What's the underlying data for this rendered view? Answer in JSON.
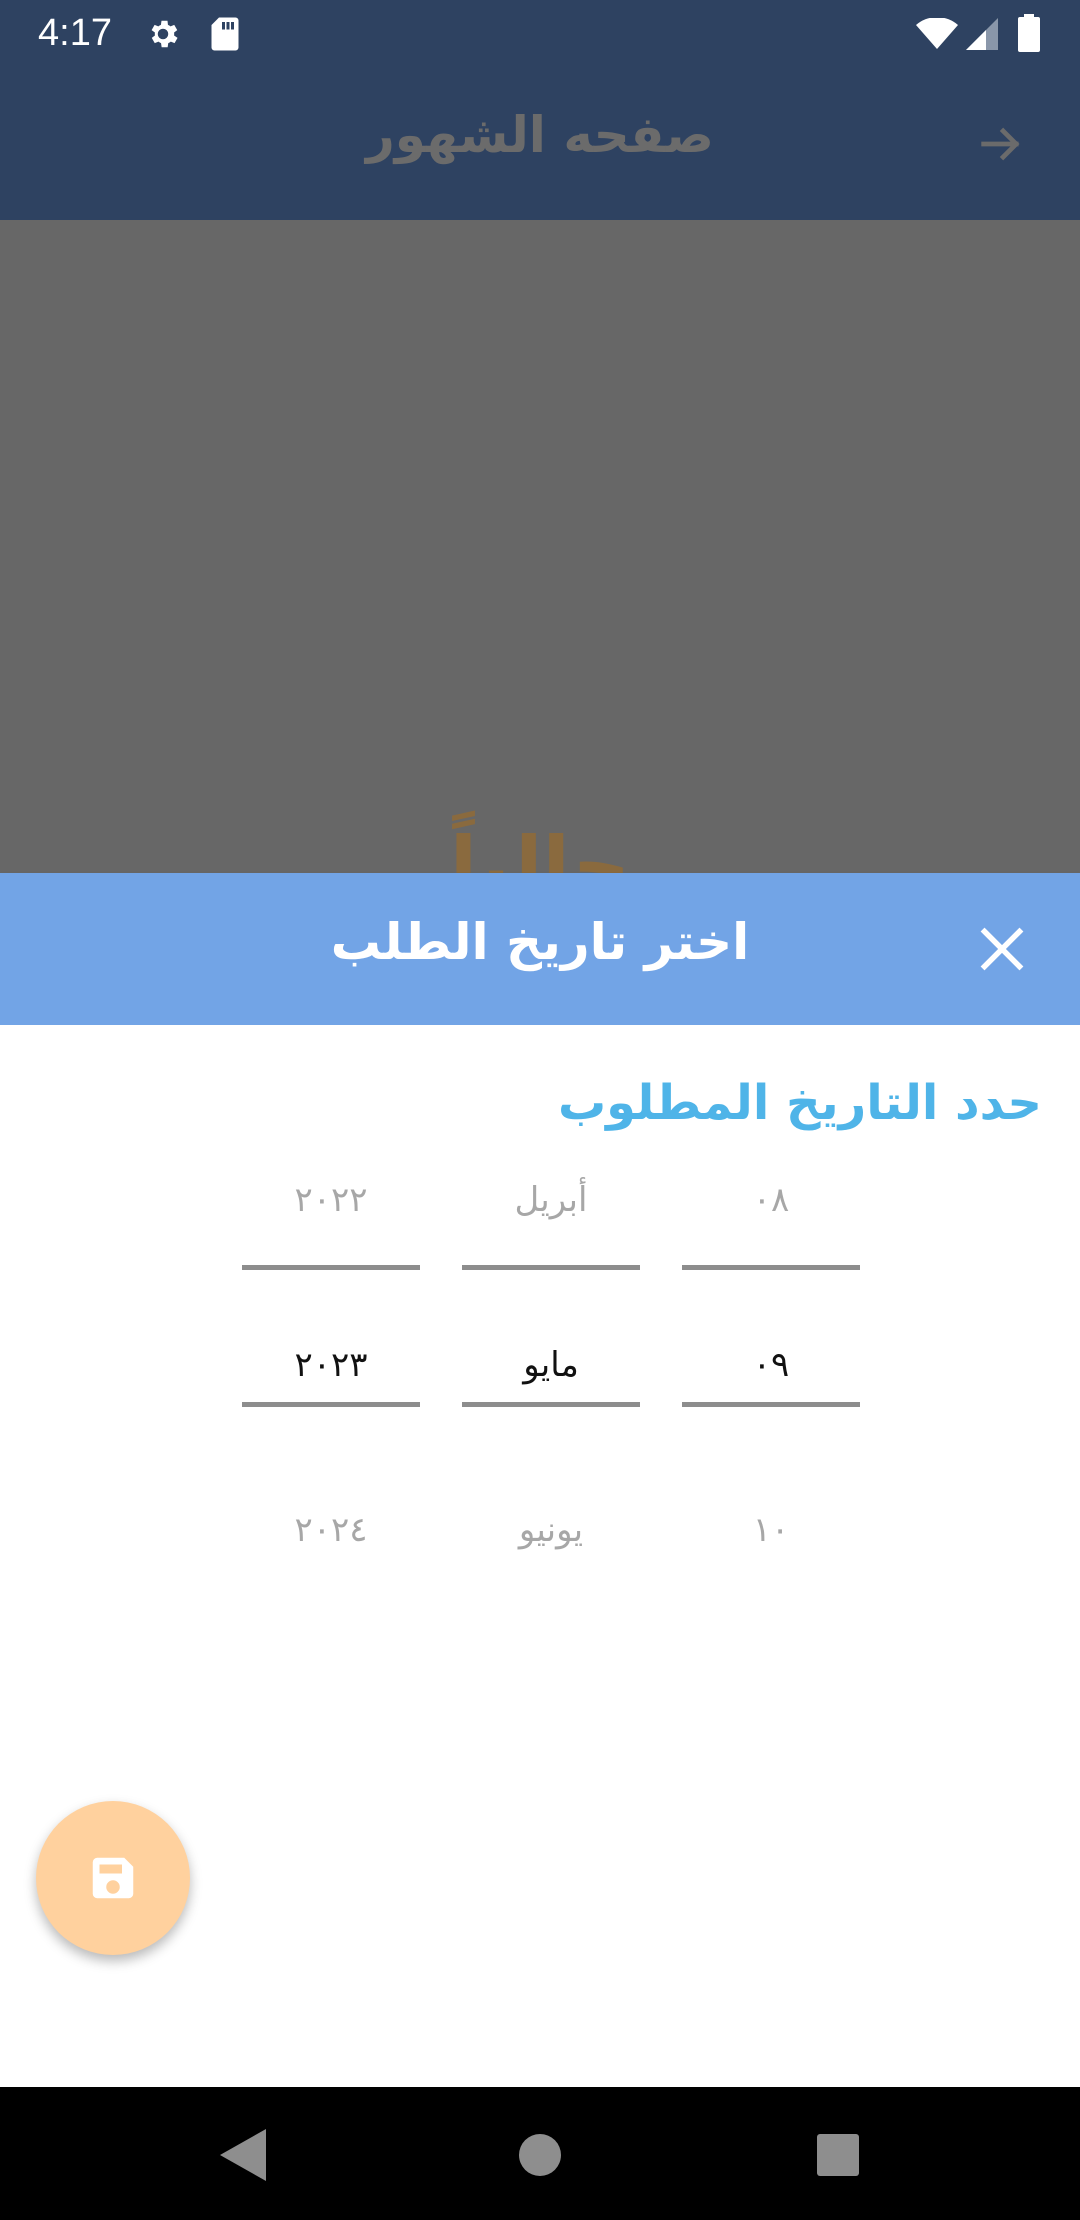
{
  "status_bar": {
    "time": "4:17",
    "icons": [
      "gear-icon",
      "sd-card-icon",
      "wifi-icon",
      "signal-icon",
      "battery-icon"
    ]
  },
  "app_bar": {
    "title": "صفحه الشهور",
    "back_icon": "arrow-right-icon",
    "background": "#2e4261"
  },
  "background_content": {
    "partial_text": "حالياً"
  },
  "sheet": {
    "title": "اختر تاريخ الطلب",
    "close_icon": "close-icon",
    "header_color": "#72a4e6",
    "section_label": "حدد التاريخ المطلوب",
    "section_label_color": "#4fb4e8"
  },
  "picker": {
    "year": {
      "prev": "٢٠٢٢",
      "selected": "٢٠٢٣",
      "next": "٢٠٢٤"
    },
    "month": {
      "prev": "أبريل",
      "selected": "مايو",
      "next": "يونيو"
    },
    "day": {
      "prev": "٠٨",
      "selected": "٠٩",
      "next": "١٠"
    }
  },
  "fab": {
    "icon": "save-icon",
    "color": "#ffd19e"
  },
  "nav_bar": {
    "icons": [
      "nav-back-icon",
      "nav-home-icon",
      "nav-recents-icon"
    ]
  }
}
